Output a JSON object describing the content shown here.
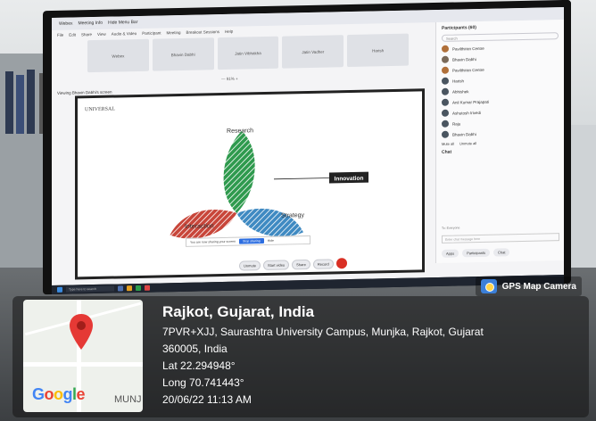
{
  "app": {
    "top_tabs": [
      "Webex",
      "Meeting Info",
      "Hide Menu Bar"
    ],
    "menu_items": [
      "File",
      "Edit",
      "Share",
      "View",
      "Audio & Video",
      "Participant",
      "Meeting",
      "Breakout Sessions",
      "Help"
    ],
    "tiles": [
      "Webex",
      "Bhavin Dabhi",
      "Jatin Vibhakha",
      "Jatin Vadher",
      "Harish"
    ],
    "zoom_label": "— 91% +",
    "viewing_label": "Viewing Bhavin Dabhi's screen"
  },
  "slide": {
    "logo": "UNIVERSAL",
    "labels": {
      "research": "Research",
      "interaction": "Interaction",
      "strategy": "Strategy",
      "innovation": "Innovation"
    },
    "colors": {
      "green": "#2f9a4e",
      "red": "#c8463a",
      "blue": "#3f8ac2",
      "dark": "#222222"
    }
  },
  "share_bar": {
    "text": "You are now sharing your screen",
    "stop": "Stop sharing",
    "hide": "Hide"
  },
  "controls": [
    "Unmute",
    "Start video",
    "Share",
    "Record"
  ],
  "participants": {
    "title": "Participants (60)",
    "search_placeholder": "Search",
    "items": [
      "Pavilthiran Centre",
      "Bhavin Dabhi",
      "Pavilthiran Centre",
      "Harish",
      "Abhishek",
      "Anil Kumar Prajapati",
      "Ashutosh trivedi",
      "Raju",
      "Bhavin Dabhi"
    ],
    "mute_all": "Mute all",
    "unmute_all": "Unmute all"
  },
  "chat": {
    "title": "Chat",
    "input_placeholder": "Enter chat message here",
    "to_label": "To: Everyone",
    "buttons": [
      "Apps",
      "Participants",
      "Chat"
    ]
  },
  "taskbar": {
    "search_placeholder": "Type here to search"
  },
  "gps": {
    "app_label": "GPS Map Camera",
    "city": "Rajkot, Gujarat, India",
    "address_line1": "7PVR+XJJ, Saurashtra University Campus, Munjka, Rajkot, Gujarat",
    "address_line2": "360005, India",
    "lat": "Lat 22.294948°",
    "long": "Long 70.741443°",
    "datetime": "20/06/22 11:13 AM",
    "map_brand": "Google",
    "map_place": "MUNJ"
  }
}
